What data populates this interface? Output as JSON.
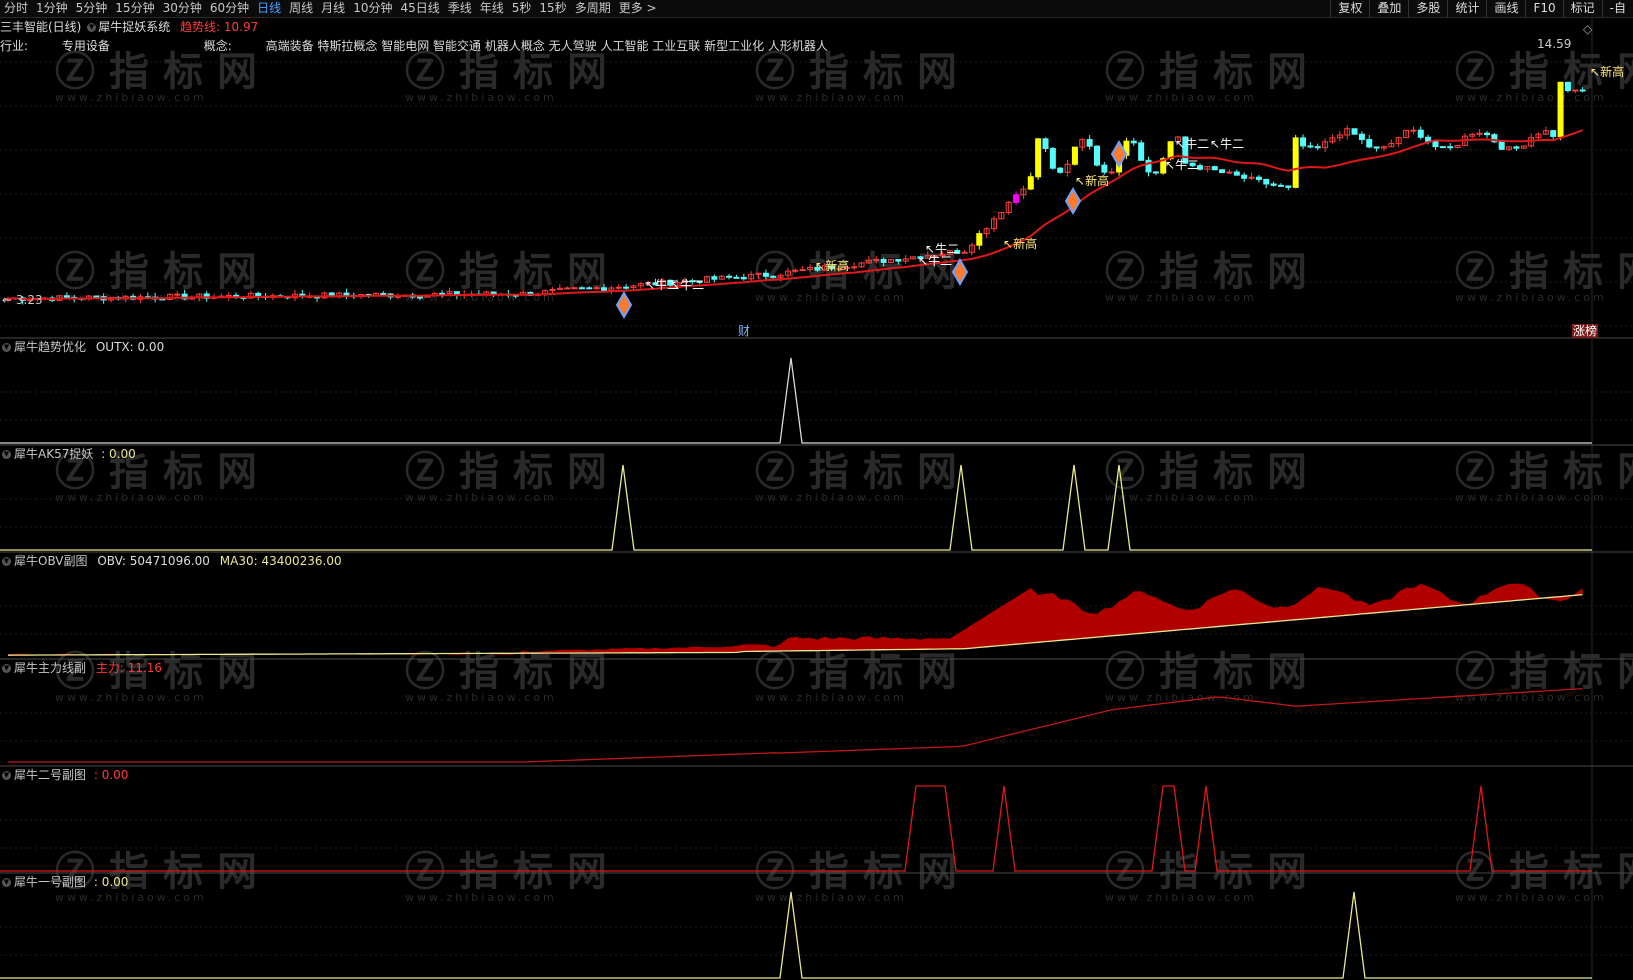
{
  "toolbar": {
    "periods": [
      "分时",
      "1分钟",
      "5分钟",
      "15分钟",
      "30分钟",
      "60分钟",
      "日线",
      "周线",
      "月线",
      "10分钟",
      "45日线",
      "季线",
      "年线",
      "5秒",
      "15秒",
      "多周期",
      "更多 >"
    ],
    "active": "日线",
    "right": [
      "复权",
      "叠加",
      "多股",
      "统计",
      "画线",
      "F10",
      "标记",
      "-自"
    ]
  },
  "title": {
    "stock": "三丰智能(日线)",
    "indicator": "犀牛捉妖系统",
    "trend_label": "趋势线: 10.97"
  },
  "info": {
    "industry_label": "行业:",
    "industry": "专用设备",
    "concept_label": "概念:",
    "concepts": "高端装备 特斯拉概念 智能电网 智能交通 机器人概念 无人驾驶 人工智能 工业互联 新型工业化 人形机器人"
  },
  "main": {
    "price_high": "14.59",
    "price_low": "3.23",
    "marks": {
      "xingao": "新高",
      "niuer": "牛二",
      "cai": "财",
      "zhangting": "涨榜"
    }
  },
  "watermark": {
    "text": "指标网",
    "url": "www.zhibiaow.com"
  },
  "panels": [
    {
      "name": "犀牛趋势优化",
      "value": "OUTX: 0.00"
    },
    {
      "name": "犀牛AK57捉妖",
      "value": ": 0.00"
    },
    {
      "name": "犀牛OBV副图",
      "value": "OBV: 50471096.00",
      "value2": "MA30: 43400236.00"
    },
    {
      "name": "犀牛主力线副",
      "value": "主力: 11.16"
    },
    {
      "name": "犀牛二号副图",
      "value": ": 0.00"
    },
    {
      "name": "犀牛一号副图",
      "value": ": 0.00"
    }
  ],
  "colors": {
    "up": "#ff3c3c",
    "down": "#54fcfc",
    "yellow": "#ffff00",
    "magenta": "#ff00ff",
    "ma": "#e01818",
    "accent": "#4aa3ff"
  }
}
